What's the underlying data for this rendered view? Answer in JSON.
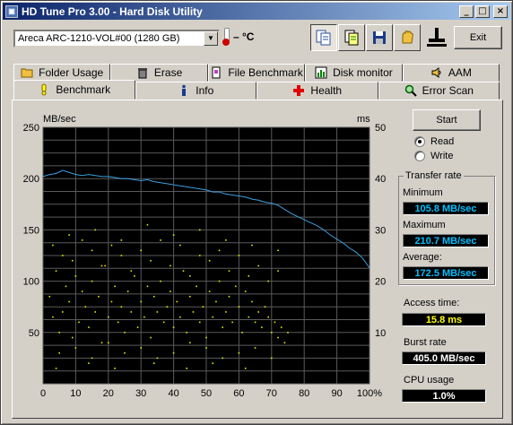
{
  "window": {
    "title": "HD Tune Pro 3.00 - Hard Disk Utility",
    "app_icon": "hd-tune-icon",
    "controls": {
      "minimize": "_",
      "maximize": "□",
      "close": "×"
    }
  },
  "toolbar": {
    "drive": "Areca   ARC-1210-VOL#00 (1280 GB)",
    "temperature": "– °C",
    "icons": [
      "copy-info-icon",
      "copy-text-icon",
      "save-icon",
      "options-icon",
      "exit-computer-icon"
    ],
    "exit_label": "Exit"
  },
  "tabs": {
    "row1": [
      {
        "label": "Folder Usage",
        "icon": "folder-icon"
      },
      {
        "label": "Erase",
        "icon": "trash-icon"
      },
      {
        "label": "File Benchmark",
        "icon": "file-icon"
      },
      {
        "label": "Disk monitor",
        "icon": "monitor-chart-icon"
      },
      {
        "label": "AAM",
        "icon": "speaker-icon"
      }
    ],
    "row2": [
      {
        "label": "Benchmark",
        "icon": "benchmark-icon",
        "selected": true
      },
      {
        "label": "Info",
        "icon": "info-icon"
      },
      {
        "label": "Health",
        "icon": "health-cross-icon"
      },
      {
        "label": "Error Scan",
        "icon": "magnifier-icon"
      }
    ]
  },
  "controls": {
    "start_label": "Start",
    "read_label": "Read",
    "write_label": "Write",
    "read_selected": true
  },
  "transfer_rate": {
    "group_title": "Transfer rate",
    "minimum_label": "Minimum",
    "minimum_value": "105.8 MB/sec",
    "maximum_label": "Maximum",
    "maximum_value": "210.7 MB/sec",
    "average_label": "Average:",
    "average_value": "172.5 MB/sec"
  },
  "stats": {
    "access_label": "Access time:",
    "access_value": "15.8 ms",
    "burst_label": "Burst rate",
    "burst_value": "405.0 MB/sec",
    "cpu_label": "CPU usage",
    "cpu_value": "1.0%"
  },
  "colors": {
    "read_line": "#3aa0e0",
    "access_points": "#e8e800",
    "plot_bg": "#000000",
    "grid": "#5a5a5a"
  },
  "chart_data": {
    "type": "line",
    "left_axis_label": "MB/sec",
    "right_axis_label": "ms",
    "x_ticks": [
      "0",
      "10",
      "20",
      "30",
      "40",
      "50",
      "60",
      "70",
      "80",
      "90",
      "100%"
    ],
    "y_left_ticks": [
      "250",
      "200",
      "150",
      "100",
      "50"
    ],
    "y_right_ticks": [
      "50",
      "40",
      "30",
      "20",
      "10"
    ],
    "xlim": [
      0,
      100
    ],
    "ylim_left": [
      0,
      250
    ],
    "ylim_right": [
      0,
      50
    ],
    "grid": true,
    "series": [
      {
        "axis": "left",
        "x": [
          0,
          2,
          4,
          6,
          8,
          10,
          12,
          14,
          16,
          18,
          20,
          22,
          24,
          26,
          28,
          30,
          32,
          34,
          36,
          38,
          40,
          42,
          44,
          46,
          48,
          50,
          52,
          54,
          56,
          58,
          60,
          62,
          64,
          66,
          68,
          70,
          72,
          74,
          76,
          78,
          80,
          82,
          84,
          86,
          88,
          90,
          92,
          94,
          96,
          98,
          100
        ],
        "y": [
          202,
          204,
          205,
          208,
          206,
          204,
          203,
          204,
          203,
          202,
          202,
          201,
          200,
          200,
          199,
          198,
          199,
          197,
          196,
          195,
          194,
          193,
          192,
          191,
          190,
          189,
          187,
          187,
          185,
          184,
          183,
          182,
          180,
          179,
          177,
          176,
          174,
          170,
          166,
          163,
          160,
          157,
          154,
          150,
          145,
          141,
          137,
          132,
          128,
          122,
          113
        ]
      },
      {
        "axis": "right",
        "kind": "scatter",
        "description_free": true,
        "x": [
          2,
          3,
          4,
          5,
          6,
          7,
          8,
          9,
          10,
          11,
          12,
          13,
          14,
          15,
          16,
          17,
          18,
          19,
          20,
          21,
          22,
          23,
          24,
          25,
          26,
          27,
          28,
          29,
          30,
          31,
          32,
          33,
          34,
          35,
          36,
          37,
          38,
          39,
          40,
          41,
          42,
          43,
          44,
          45,
          46,
          47,
          48,
          49,
          50,
          51,
          52,
          53,
          54,
          55,
          56,
          57,
          58,
          59,
          60,
          61,
          62,
          63,
          64,
          65,
          66,
          67,
          68,
          69,
          70,
          71,
          72,
          73,
          74,
          75,
          3,
          6,
          9,
          12,
          15,
          18,
          21,
          24,
          27,
          30,
          33,
          36,
          39,
          42,
          45,
          48,
          51,
          54,
          57,
          60,
          63,
          66,
          69,
          72,
          5,
          10,
          15,
          20,
          25,
          30,
          35,
          40,
          45,
          50,
          55,
          60,
          65,
          70,
          8,
          16,
          24,
          32,
          40,
          48,
          56,
          64,
          72,
          4,
          14,
          22,
          34,
          44,
          52,
          62
        ],
        "y": [
          17,
          13,
          22,
          10,
          14,
          19,
          16,
          9,
          21,
          12,
          18,
          15,
          11,
          20,
          14,
          17,
          8,
          23,
          13,
          16,
          19,
          12,
          15,
          10,
          18,
          14,
          21,
          11,
          16,
          13,
          19,
          9,
          17,
          14,
          20,
          12,
          15,
          18,
          11,
          16,
          13,
          22,
          10,
          17,
          14,
          19,
          12,
          15,
          9,
          18,
          13,
          16,
          20,
          11,
          14,
          17,
          12,
          19,
          15,
          10,
          18,
          13,
          16,
          12,
          14,
          11,
          15,
          13,
          10,
          12,
          9,
          11,
          8,
          10,
          27,
          25,
          24,
          28,
          26,
          23,
          27,
          25,
          22,
          26,
          24,
          28,
          23,
          27,
          21,
          25,
          24,
          26,
          22,
          25,
          21,
          23,
          20,
          22,
          6,
          7,
          5,
          8,
          6,
          7,
          5,
          6,
          8,
          7,
          5,
          6,
          7,
          5,
          29,
          30,
          28,
          31,
          29,
          30,
          28,
          27,
          26,
          3,
          4,
          3,
          4,
          3,
          4,
          3
        ]
      }
    ]
  }
}
